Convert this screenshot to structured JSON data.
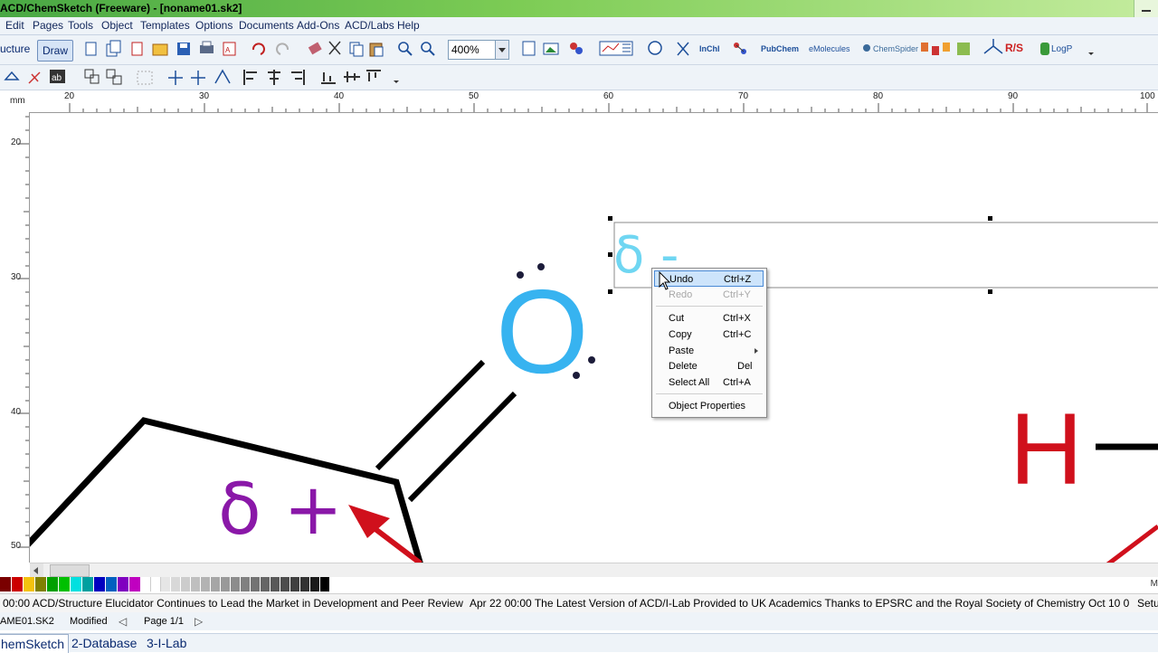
{
  "window": {
    "title": "ACD/ChemSketch (Freeware) - [noname01.sk2]"
  },
  "menu": [
    "Edit",
    "Pages",
    "Tools",
    "Object",
    "Templates",
    "Options",
    "Documents",
    "Add-Ons",
    "ACD/Labs",
    "Help"
  ],
  "toolbar": {
    "mode_label": "ucture",
    "draw_label": "Draw",
    "zoom_value": "400%",
    "inchi_label": "InChI",
    "pubchem_label": "PubChem",
    "emolecules_label": "eMolecules",
    "chemspider_label": "ChemSpider",
    "rs_label": "R/S",
    "logp_label": "LogP"
  },
  "ruler": {
    "unit": "mm",
    "h_ticks": [
      "20",
      "30",
      "40",
      "50",
      "60",
      "70",
      "80",
      "90",
      "100"
    ],
    "v_ticks": [
      "20",
      "30",
      "40",
      "50"
    ]
  },
  "canvas": {
    "oxygen_label": "O",
    "delta_minus": "δ -",
    "delta_plus": "δ +",
    "hydrogen_label": "H",
    "colors": {
      "oxygen": "#37b3f0",
      "delta_minus": "#6fd6f2",
      "delta_plus": "#8a18a8",
      "hydrogen": "#d0101c",
      "arrow": "#d0101c",
      "bond": "#000000"
    }
  },
  "context_menu": {
    "items": [
      {
        "label": "Undo",
        "shortcut": "Ctrl+Z",
        "state": "highlighted"
      },
      {
        "label": "Redo",
        "shortcut": "Ctrl+Y",
        "state": "disabled"
      },
      {
        "label": "Cut",
        "shortcut": "Ctrl+X",
        "state": "normal"
      },
      {
        "label": "Copy",
        "shortcut": "Ctrl+C",
        "state": "normal"
      },
      {
        "label": "Paste",
        "shortcut": "",
        "state": "submenu"
      },
      {
        "label": "Delete",
        "shortcut": "Del",
        "state": "normal"
      },
      {
        "label": "Select All",
        "shortcut": "Ctrl+A",
        "state": "normal"
      },
      {
        "label": "Object Properties",
        "shortcut": "",
        "state": "normal"
      }
    ]
  },
  "palette": {
    "colors": [
      "#7a0000",
      "#cc0000",
      "#f4c20d",
      "#808000",
      "#00a000",
      "#00c000",
      "#00e0e0",
      "#00a0a0",
      "#0000c0",
      "#0060c0",
      "#8000c0",
      "#c000c0",
      "#ffffff",
      "#ffffff",
      "#e6e6e6",
      "#d8d8d8",
      "#cccccc",
      "#bfbfbf",
      "#b3b3b3",
      "#a6a6a6",
      "#999999",
      "#8c8c8c",
      "#808080",
      "#737373",
      "#666666",
      "#595959",
      "#4d4d4d",
      "#404040",
      "#333333",
      "#1a1a1a",
      "#000000"
    ],
    "right_label": "M"
  },
  "news": {
    "items": [
      "00:00 ACD/Structure Elucidator Continues to Lead the Market in Development and Peer Review",
      "Apr 22 00:00 The Latest Version of ACD/I-Lab Provided to UK Academics Thanks to EPSRC and the Royal Society of Chemistry",
      "Oct 10 0"
    ],
    "setup_label": "Setup"
  },
  "status": {
    "file": "AME01.SK2",
    "state": "Modified",
    "page": "Page 1/1"
  },
  "tabs": [
    "hemSketch",
    "2-Database",
    "3-I-Lab"
  ]
}
